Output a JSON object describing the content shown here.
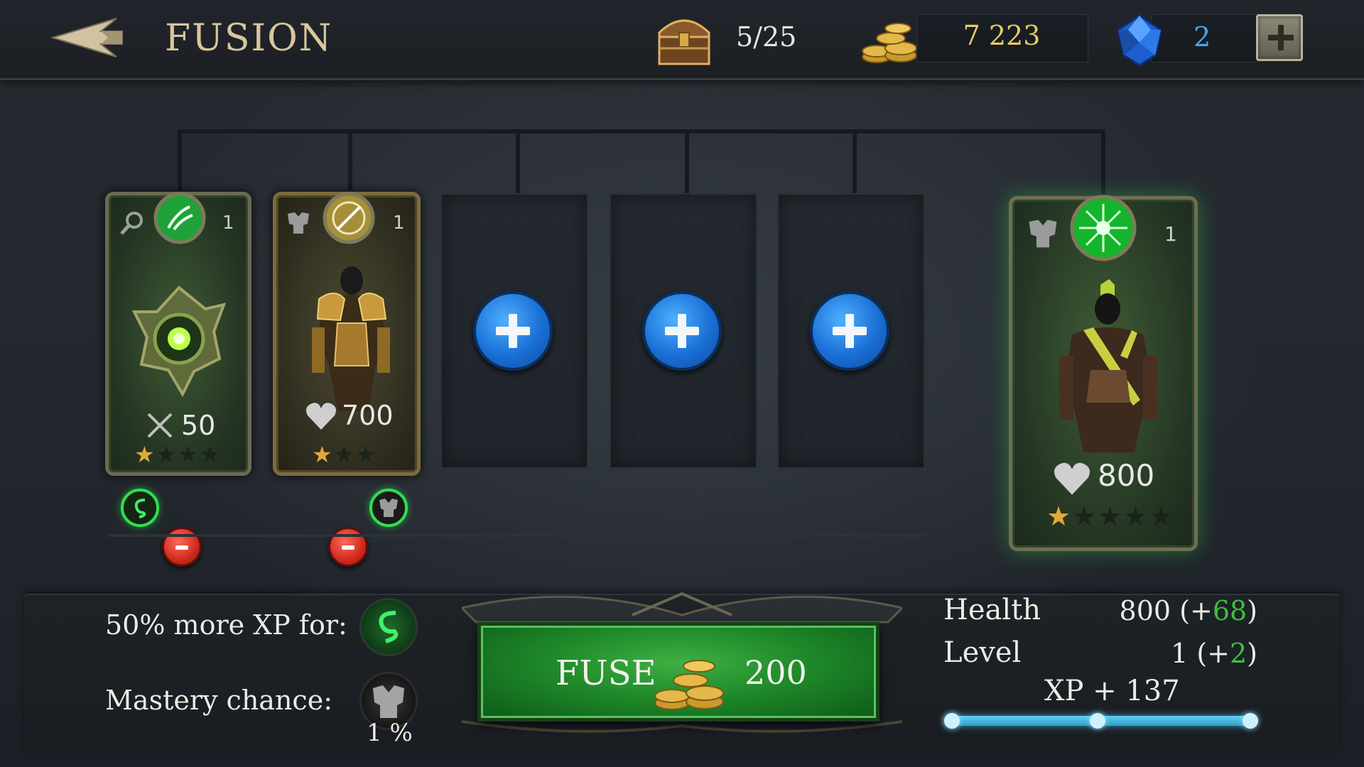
{
  "header": {
    "title": "FUSION",
    "inventory_count": "5/25",
    "gold": "7 223",
    "gems": "2"
  },
  "materials": [
    {
      "kind": "weapon",
      "type_icon": "magnifier-icon",
      "badge_icon": "agility-icon",
      "level": "1",
      "stat_icon": "crossed-swords-icon",
      "stat_value": "50",
      "stars_filled": 1,
      "stars_total": 4,
      "bonus_icon": "serpent-icon"
    },
    {
      "kind": "armor",
      "type_icon": "chestplate-icon",
      "badge_icon": "sword-emblem-icon",
      "level": "1",
      "stat_icon": "heart-icon",
      "stat_value": "700",
      "stars_filled": 1,
      "stars_total": 3,
      "bonus_icon": "chestplate-icon"
    }
  ],
  "empty_slots": 3,
  "result": {
    "type_icon": "chestplate-icon",
    "badge_icon": "green-burst-icon",
    "level": "1",
    "stat_icon": "heart-icon",
    "stat_value": "800",
    "stars_filled": 1,
    "stars_total": 5
  },
  "bonus": {
    "xp_label": "50% more XP for:",
    "mastery_label": "Mastery chance:",
    "mastery_value": "1 %"
  },
  "fuse": {
    "label": "FUSE",
    "cost": "200"
  },
  "stats": {
    "health_label": "Health",
    "health_value": "800 (+",
    "health_bonus": "68",
    "health_close": ")",
    "level_label": "Level",
    "level_value": "1 (+",
    "level_bonus": "2",
    "level_close": ")",
    "xp_text": "XP + 137",
    "xp_progress": 0.5
  },
  "colors": {
    "gold_text": "#e9c86a",
    "gem_text": "#4aa6ee",
    "bonus_green": "#3ec03e",
    "fuse_green": "#1f8a2a",
    "add_blue": "#1a6fd6",
    "remove_red": "#cf2a1d"
  }
}
